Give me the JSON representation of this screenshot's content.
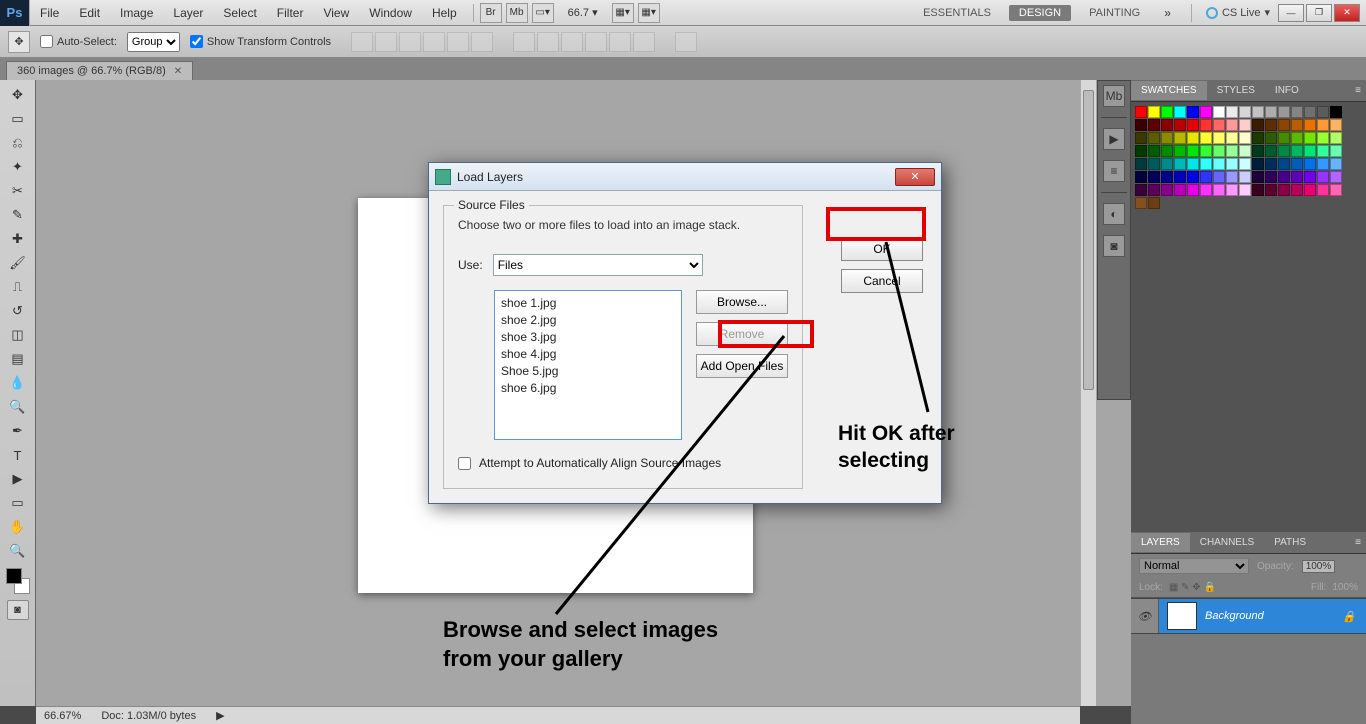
{
  "menu": {
    "items": [
      "File",
      "Edit",
      "Image",
      "Layer",
      "Select",
      "Filter",
      "View",
      "Window",
      "Help"
    ],
    "zoom": "66.7",
    "workspaces": [
      "ESSENTIALS",
      "DESIGN",
      "PAINTING"
    ],
    "cslive": "CS Live"
  },
  "options": {
    "auto_select": "Auto-Select:",
    "auto_select_mode": "Group",
    "show_transform": "Show Transform Controls"
  },
  "doc_tab": {
    "label": "360 images @ 66.7% (RGB/8)"
  },
  "status": {
    "zoom": "66.67%",
    "doc": "Doc: 1.03M/0 bytes"
  },
  "panels": {
    "swatches_tabs": [
      "SWATCHES",
      "STYLES",
      "INFO"
    ],
    "layers_tabs": [
      "LAYERS",
      "CHANNELS",
      "PATHS"
    ],
    "layers": {
      "blend": "Normal",
      "opacity_label": "Opacity:",
      "opacity_val": "100%",
      "lock_label": "Lock:",
      "fill_label": "Fill:",
      "fill_val": "100%",
      "layer_name": "Background"
    }
  },
  "dialog": {
    "title": "Load Layers",
    "source_legend": "Source Files",
    "instruction": "Choose two or more files to load into an image stack.",
    "use_label": "Use:",
    "use_value": "Files",
    "files": [
      "shoe 1.jpg",
      "shoe 2.jpg",
      "shoe 3.jpg",
      "shoe 4.jpg",
      "Shoe 5.jpg",
      "shoe 6.jpg"
    ],
    "browse": "Browse...",
    "remove": "Remove",
    "add_open": "Add Open Files",
    "align": "Attempt to Automatically Align Source Images",
    "ok": "OK",
    "cancel": "Cancel"
  },
  "annotations": {
    "ok_text": "Hit OK after selecting",
    "browse_text": "Browse and select images from your gallery"
  },
  "swatch_colors": [
    "#ff0000",
    "#ffff00",
    "#00ff00",
    "#00ffff",
    "#0000ff",
    "#ff00ff",
    "#ffffff",
    "#ebebeb",
    "#d6d6d6",
    "#c2c2c2",
    "#adadad",
    "#999999",
    "#858585",
    "#707070",
    "#5c5c5c",
    "#000000",
    "#3a0000",
    "#5c0000",
    "#8a0000",
    "#b80000",
    "#e60000",
    "#ff3333",
    "#ff6666",
    "#ff9999",
    "#ffcccc",
    "#3a1d00",
    "#5c2e00",
    "#8a4600",
    "#b85d00",
    "#e67300",
    "#ff9933",
    "#ffb366",
    "#3a3a00",
    "#5c5c00",
    "#8a8a00",
    "#b8b800",
    "#e6e600",
    "#ffff33",
    "#ffff66",
    "#ffff99",
    "#ffffcc",
    "#1d3a00",
    "#2e5c00",
    "#468a00",
    "#5db800",
    "#73e600",
    "#99ff33",
    "#b3ff66",
    "#003a00",
    "#005c00",
    "#008a00",
    "#00b800",
    "#00e600",
    "#33ff33",
    "#66ff66",
    "#99ff99",
    "#ccffcc",
    "#003a1d",
    "#005c2e",
    "#008a46",
    "#00b85d",
    "#00e673",
    "#33ff99",
    "#66ffb3",
    "#003a3a",
    "#005c5c",
    "#008a8a",
    "#00b8b8",
    "#00e6e6",
    "#33ffff",
    "#66ffff",
    "#99ffff",
    "#ccffff",
    "#001d3a",
    "#002e5c",
    "#00468a",
    "#005db8",
    "#0073e6",
    "#3399ff",
    "#66b3ff",
    "#00003a",
    "#00005c",
    "#00008a",
    "#0000b8",
    "#0000e6",
    "#3333ff",
    "#6666ff",
    "#9999ff",
    "#ccccff",
    "#1d003a",
    "#2e005c",
    "#46008a",
    "#5d00b8",
    "#7300e6",
    "#9933ff",
    "#b366ff",
    "#3a003a",
    "#5c005c",
    "#8a008a",
    "#b800b8",
    "#e600e6",
    "#ff33ff",
    "#ff66ff",
    "#ff99ff",
    "#ffccff",
    "#3a001d",
    "#5c002e",
    "#8a0046",
    "#b8005d",
    "#e60073",
    "#ff3399",
    "#ff66b3",
    "#845020",
    "#6b3e14"
  ]
}
